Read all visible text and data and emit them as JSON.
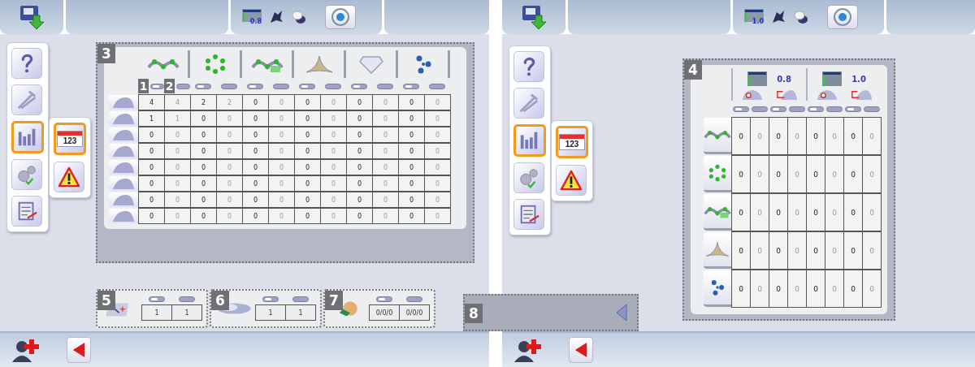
{
  "screens": [
    {
      "top_bar": {
        "readout": "0.8"
      },
      "sidebar": [
        {
          "kind": "help",
          "selected": false
        },
        {
          "kind": "tools",
          "selected": false
        },
        {
          "kind": "chart",
          "selected": true
        },
        {
          "kind": "gears",
          "selected": false
        },
        {
          "kind": "document",
          "selected": false
        }
      ],
      "submenu": [
        {
          "kind": "calendar",
          "label": "123",
          "selected": true
        },
        {
          "kind": "warning",
          "selected": false
        }
      ],
      "table_panel": {
        "kind": "wide",
        "callout": "3",
        "groups": [
          {
            "kind": "chain"
          },
          {
            "kind": "ring"
          },
          {
            "kind": "chain-mh"
          },
          {
            "kind": "triangle"
          },
          {
            "kind": "diamond"
          },
          {
            "kind": "cluster"
          }
        ],
        "columns": [
          {
            "on": true,
            "callout": "1"
          },
          {
            "on": false,
            "callout": "2"
          },
          {
            "on": true
          },
          {
            "on": false
          },
          {
            "on": true
          },
          {
            "on": false
          },
          {
            "on": true
          },
          {
            "on": false
          },
          {
            "on": true
          },
          {
            "on": false
          },
          {
            "on": true
          },
          {
            "on": false
          }
        ],
        "rows": [
          {
            "cells": [
              "4",
              "4",
              "2",
              "2",
              "0",
              "0",
              "0",
              "0",
              "0",
              "0",
              "0",
              "0"
            ]
          },
          {
            "cells": [
              "1",
              "1",
              "0",
              "0",
              "0",
              "0",
              "0",
              "0",
              "0",
              "0",
              "0",
              "0"
            ]
          },
          {
            "cells": [
              "0",
              "0",
              "0",
              "0",
              "0",
              "0",
              "0",
              "0",
              "0",
              "0",
              "0",
              "0"
            ]
          },
          {
            "cells": [
              "0",
              "0",
              "0",
              "0",
              "0",
              "0",
              "0",
              "0",
              "0",
              "0",
              "0",
              "0"
            ]
          },
          {
            "cells": [
              "0",
              "0",
              "0",
              "0",
              "0",
              "0",
              "0",
              "0",
              "0",
              "0",
              "0",
              "0"
            ]
          },
          {
            "cells": [
              "0",
              "0",
              "0",
              "0",
              "0",
              "0",
              "0",
              "0",
              "0",
              "0",
              "0",
              "0"
            ]
          },
          {
            "cells": [
              "0",
              "0",
              "0",
              "0",
              "0",
              "0",
              "0",
              "0",
              "0",
              "0",
              "0",
              "0"
            ]
          },
          {
            "cells": [
              "0",
              "0",
              "0",
              "0",
              "0",
              "0",
              "0",
              "0",
              "0",
              "0",
              "0",
              "0"
            ]
          }
        ]
      },
      "bottom_panels": [
        {
          "callout": "5",
          "kind": "pen",
          "cells": [
            {
              "on": true,
              "value": "1"
            },
            {
              "on": false,
              "value": "1"
            }
          ]
        },
        {
          "callout": "6",
          "kind": "lens",
          "cells": [
            {
              "on": true,
              "value": "1"
            },
            {
              "on": false,
              "value": "1"
            }
          ]
        },
        {
          "callout": "7",
          "kind": "coins",
          "cells": [
            {
              "on": true,
              "value": "0/0/0"
            },
            {
              "on": false,
              "value": "0/0/0"
            }
          ]
        }
      ],
      "scroll_panel": {
        "callout": "8"
      }
    },
    {
      "top_bar": {
        "readout": "1.0"
      },
      "sidebar": [
        {
          "kind": "help",
          "selected": false
        },
        {
          "kind": "tools",
          "selected": false
        },
        {
          "kind": "chart",
          "selected": true
        },
        {
          "kind": "gears",
          "selected": false
        },
        {
          "kind": "document",
          "selected": false
        }
      ],
      "submenu": [
        {
          "kind": "calendar",
          "label": "123",
          "selected": true
        },
        {
          "kind": "warning",
          "selected": false
        }
      ],
      "table_panel": {
        "kind": "compact",
        "callout": "4",
        "groups": [
          {
            "readout": "0.8",
            "columns": [
              {
                "on": true
              },
              {
                "on": false
              },
              {
                "on": true
              },
              {
                "on": false
              }
            ]
          },
          {
            "readout": "1.0",
            "columns": [
              {
                "on": true
              },
              {
                "on": false
              },
              {
                "on": true
              },
              {
                "on": false
              }
            ]
          }
        ],
        "rows": [
          {
            "kind": "chain",
            "cells": [
              "0",
              "0",
              "0",
              "0",
              "0",
              "0",
              "0",
              "0"
            ]
          },
          {
            "kind": "ring",
            "cells": [
              "0",
              "0",
              "0",
              "0",
              "0",
              "0",
              "0",
              "0"
            ]
          },
          {
            "kind": "chain-mh",
            "cells": [
              "0",
              "0",
              "0",
              "0",
              "0",
              "0",
              "0",
              "0"
            ]
          },
          {
            "kind": "triangle",
            "cells": [
              "0",
              "0",
              "0",
              "0",
              "0",
              "0",
              "0",
              "0"
            ]
          },
          {
            "kind": "cluster",
            "cells": [
              "0",
              "0",
              "0",
              "0",
              "0",
              "0",
              "0",
              "0"
            ]
          }
        ]
      }
    }
  ]
}
